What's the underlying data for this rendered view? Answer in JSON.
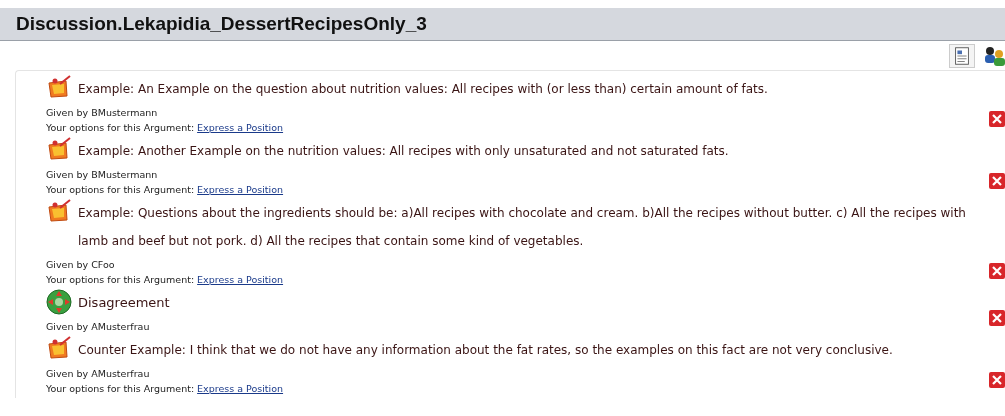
{
  "title": "Discussion.Lekapidia_DessertRecipesOnly_3",
  "arguments": [
    {
      "kind": "example",
      "text": "Example: An Example on the question about nutrition values: All recipes with (or less than) certain amount of fats.",
      "given_by": "Given by BMustermann",
      "options_label": "Your options for this Argument:",
      "options_link": "Express a Position"
    },
    {
      "kind": "example",
      "text": "Example: Another Example on the nutrition values: All recipes with only unsaturated and not saturated fats.",
      "given_by": "Given by BMustermann",
      "options_label": "Your options for this Argument:",
      "options_link": "Express a Position"
    },
    {
      "kind": "example",
      "text": "Example: Questions about the ingredients should be: a)All recipes with chocolate and cream. b)All the recipes without butter. c) All the recipes with lamb and beef but not pork. d) All the recipes that contain some kind of vegetables.",
      "given_by": "Given by CFoo",
      "options_label": "Your options for this Argument:",
      "options_link": "Express a Position"
    },
    {
      "kind": "disagreement",
      "text": "Disagreement",
      "given_by": "Given by AMusterfrau"
    },
    {
      "kind": "example",
      "text": "Counter Example: I think that we do not have any information about the fat rates, so the examples on this fact are not very conclusive.",
      "given_by": "Given by AMusterfrau",
      "options_label": "Your options for this Argument:",
      "options_link": "Express a Position"
    }
  ]
}
